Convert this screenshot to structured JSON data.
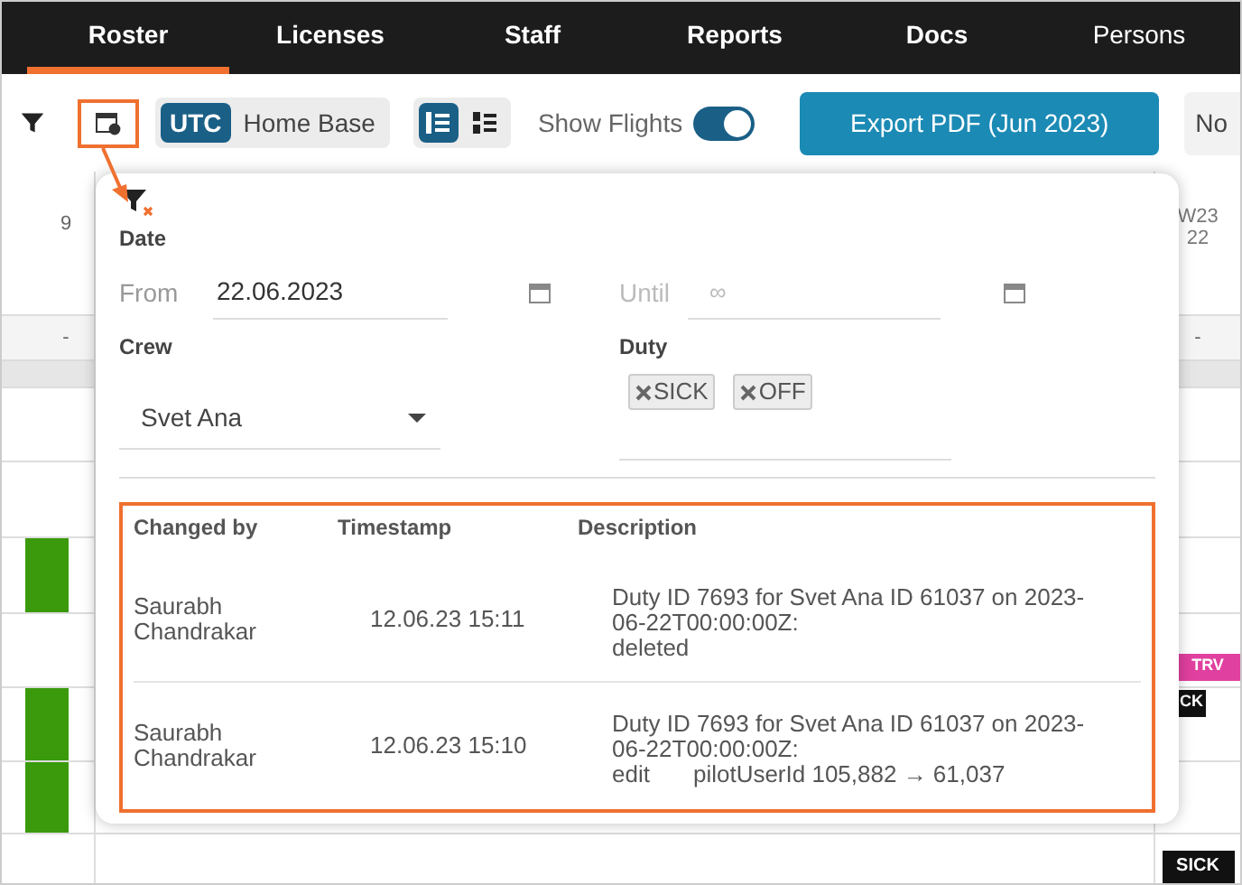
{
  "nav": {
    "tabs": [
      {
        "label": "Roster",
        "selected": true
      },
      {
        "label": "Licenses",
        "selected": false
      },
      {
        "label": "Staff",
        "selected": false
      },
      {
        "label": "Reports",
        "selected": false
      },
      {
        "label": "Docs",
        "selected": false
      },
      {
        "label": "Persons",
        "selected": false
      }
    ]
  },
  "toolbar": {
    "timezone_options": [
      {
        "label": "UTC",
        "selected": true
      },
      {
        "label": "Home Base",
        "selected": false
      }
    ],
    "view_options": [
      {
        "selected": true
      },
      {
        "selected": false
      }
    ],
    "show_flights": {
      "label": "Show Flights",
      "on": true
    },
    "export_button": "Export PDF (Jun 2023)",
    "cut_button": "No"
  },
  "roster": {
    "left_header": "9",
    "right_header": [
      "W23",
      "22"
    ],
    "day_markers": [
      "-",
      "-"
    ],
    "badges": [
      {
        "label": "TRV",
        "color": "#e0409f"
      },
      {
        "label": "CK",
        "color": "#111111"
      },
      {
        "label": "SICK",
        "color": "#111111"
      }
    ]
  },
  "popover": {
    "date_label": "Date",
    "from": {
      "label": "From",
      "value": "22.06.2023"
    },
    "until": {
      "label": "Until",
      "placeholder": "∞"
    },
    "crew": {
      "label": "Crew",
      "value": "Svet Ana"
    },
    "duty": {
      "label": "Duty",
      "tags": [
        "SICK",
        "OFF"
      ]
    },
    "table": {
      "columns": [
        "Changed by",
        "Timestamp",
        "Description"
      ],
      "rows": [
        {
          "changed_by": "Saurabh Chandrakar",
          "timestamp": "12.06.23 15:11",
          "summary": "Duty ID 7693 for Svet Ana ID 61037 on 2023-06-22T00:00:00Z:",
          "action": "deleted"
        },
        {
          "changed_by": "Saurabh Chandrakar",
          "timestamp": "12.06.23 15:10",
          "summary": "Duty ID 7693 for Svet Ana ID 61037 on 2023-06-22T00:00:00Z:",
          "action": "edit",
          "detail": "pilotUserId 105,882 → 61,037"
        }
      ]
    }
  }
}
